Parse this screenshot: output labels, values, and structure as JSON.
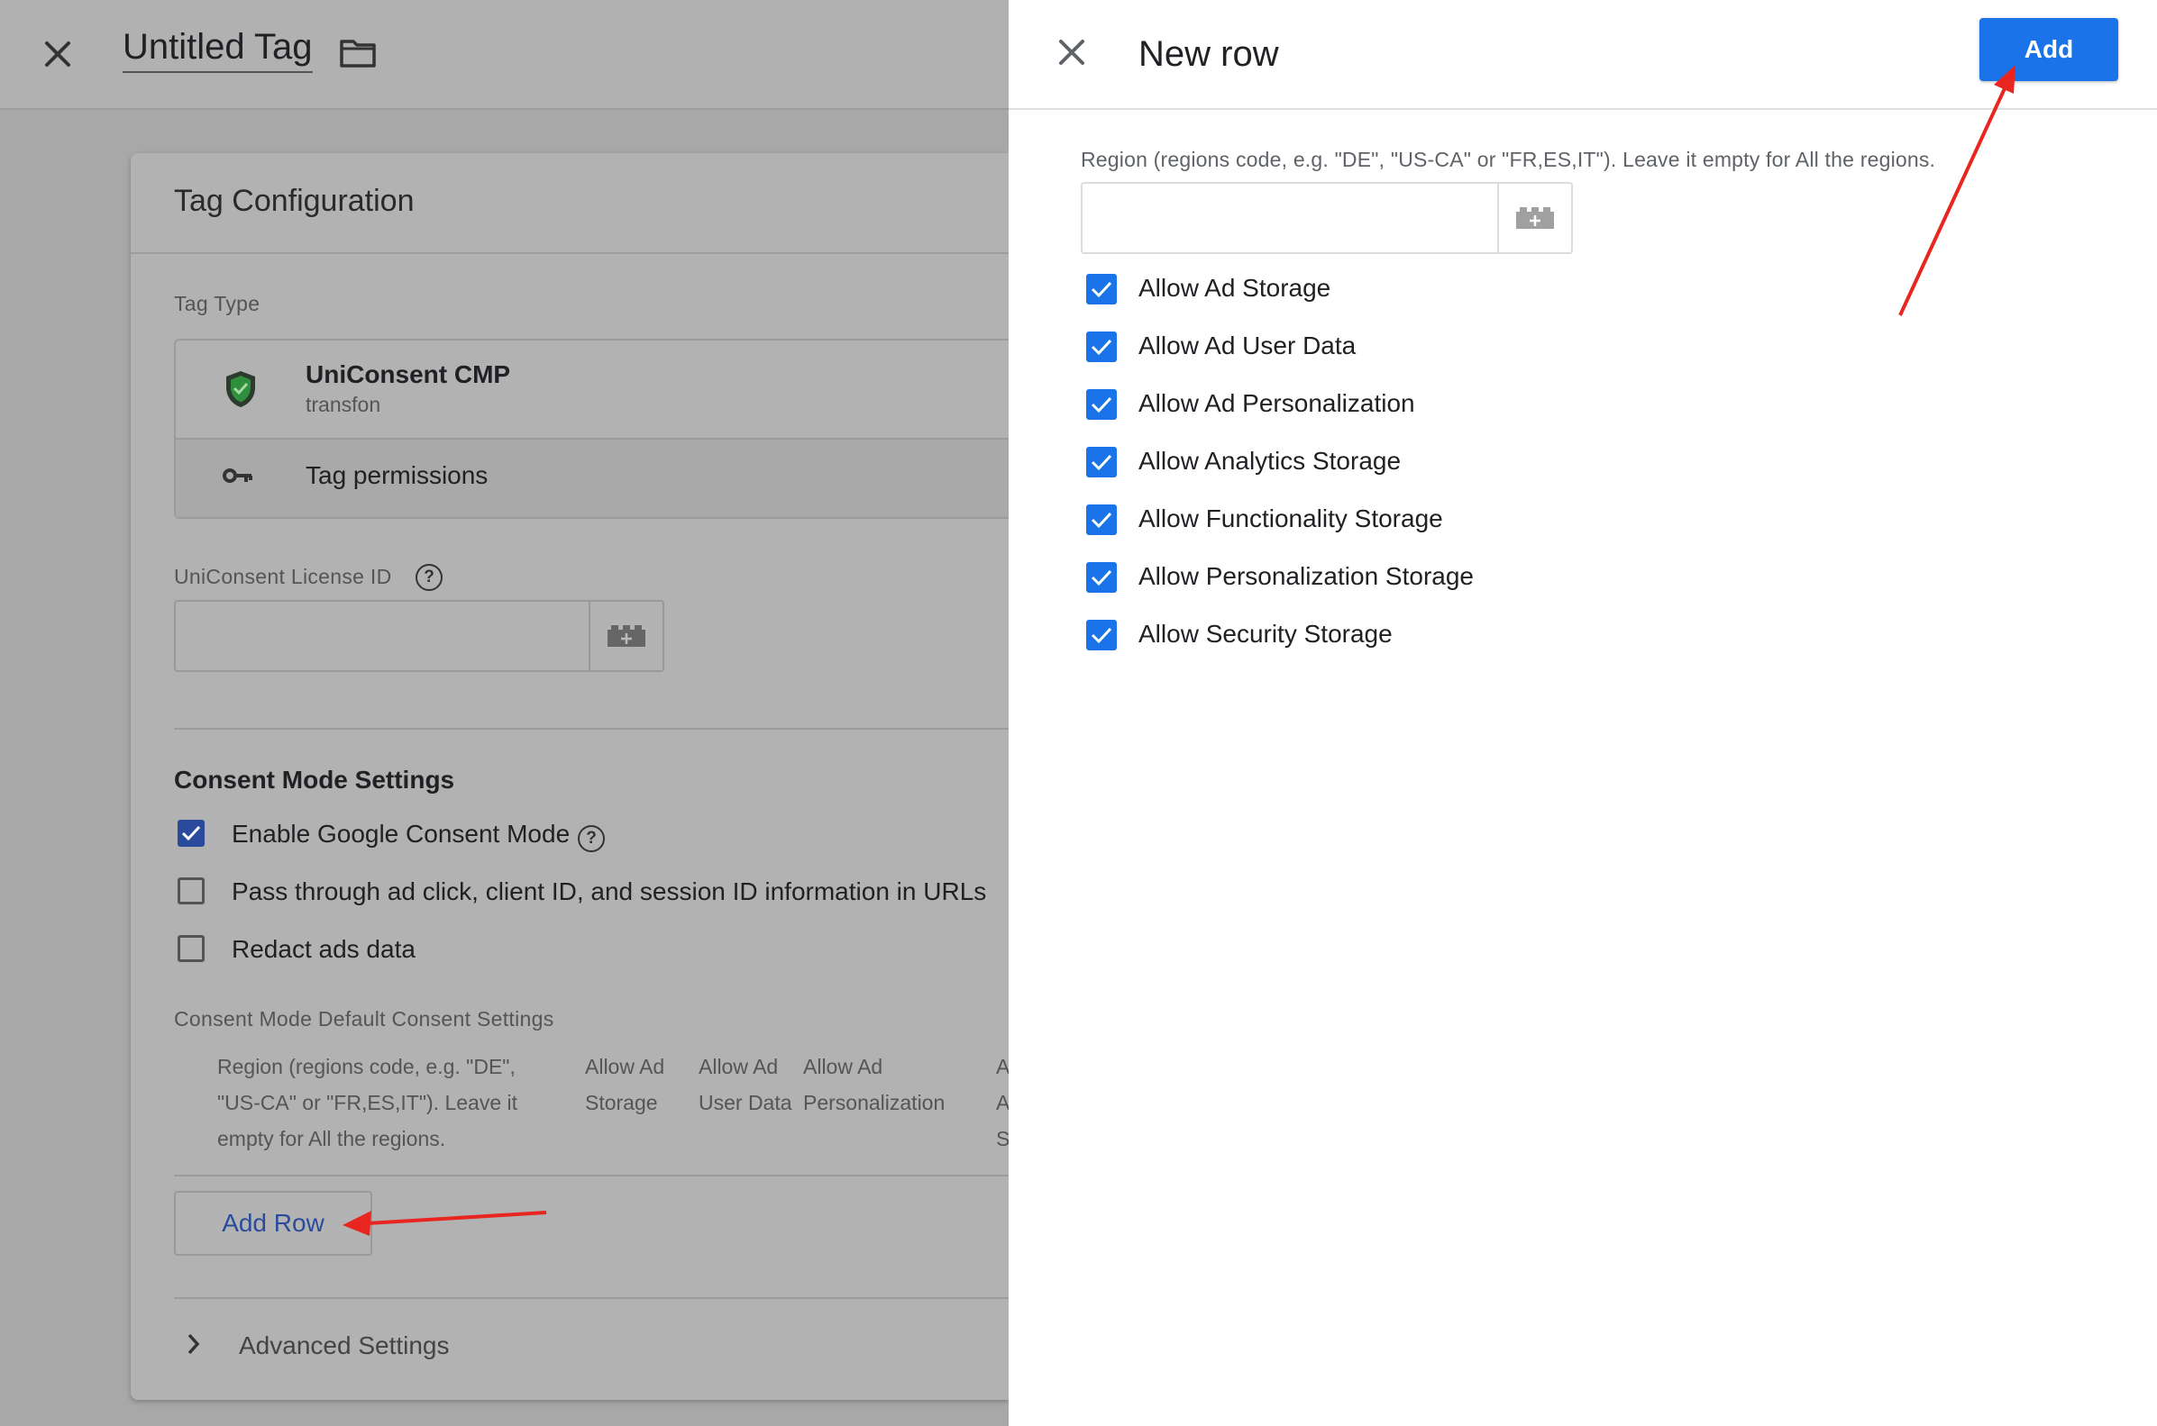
{
  "editor": {
    "title": "Untitled Tag",
    "card": {
      "title": "Tag Configuration",
      "tag_type_label": "Tag Type",
      "tag_type": {
        "name": "UniConsent CMP",
        "vendor": "transfon",
        "permissions_label": "Tag permissions"
      },
      "license_label": "UniConsent License ID",
      "license_value": "",
      "consent_section_title": "Consent Mode Settings",
      "checkboxes": [
        {
          "label": "Enable Google Consent Mode",
          "checked": true
        },
        {
          "label": "Pass through ad click, client ID, and session ID information in URLs",
          "checked": false
        },
        {
          "label": "Redact ads data",
          "checked": false
        }
      ],
      "defaults_label": "Consent Mode Default Consent Settings",
      "table_headers": [
        [
          "Region (regions code, e.g. \"DE\",",
          "\"US-CA\" or \"FR,ES,IT\"). Leave it",
          "empty for All the regions."
        ],
        [
          "Allow Ad",
          "Storage"
        ],
        [
          "Allow Ad",
          "User Data"
        ],
        [
          "Allow Ad",
          "Personalization"
        ],
        [
          "A",
          "A",
          "S"
        ]
      ],
      "add_row_label": "Add Row",
      "advanced_label": "Advanced Settings"
    }
  },
  "panel": {
    "title": "New row",
    "add_label": "Add",
    "region_label": "Region (regions code, e.g. \"DE\", \"US-CA\" or \"FR,ES,IT\"). Leave it empty for All the regions.",
    "region_value": "",
    "options": [
      {
        "label": "Allow Ad Storage",
        "checked": true
      },
      {
        "label": "Allow Ad User Data",
        "checked": true
      },
      {
        "label": "Allow Ad Personalization",
        "checked": true
      },
      {
        "label": "Allow Analytics Storage",
        "checked": true
      },
      {
        "label": "Allow Functionality Storage",
        "checked": true
      },
      {
        "label": "Allow Personalization Storage",
        "checked": true
      },
      {
        "label": "Allow Security Storage",
        "checked": true
      }
    ]
  },
  "colors": {
    "accent": "#1a73e8",
    "annotation_arrow": "#e8261f"
  }
}
